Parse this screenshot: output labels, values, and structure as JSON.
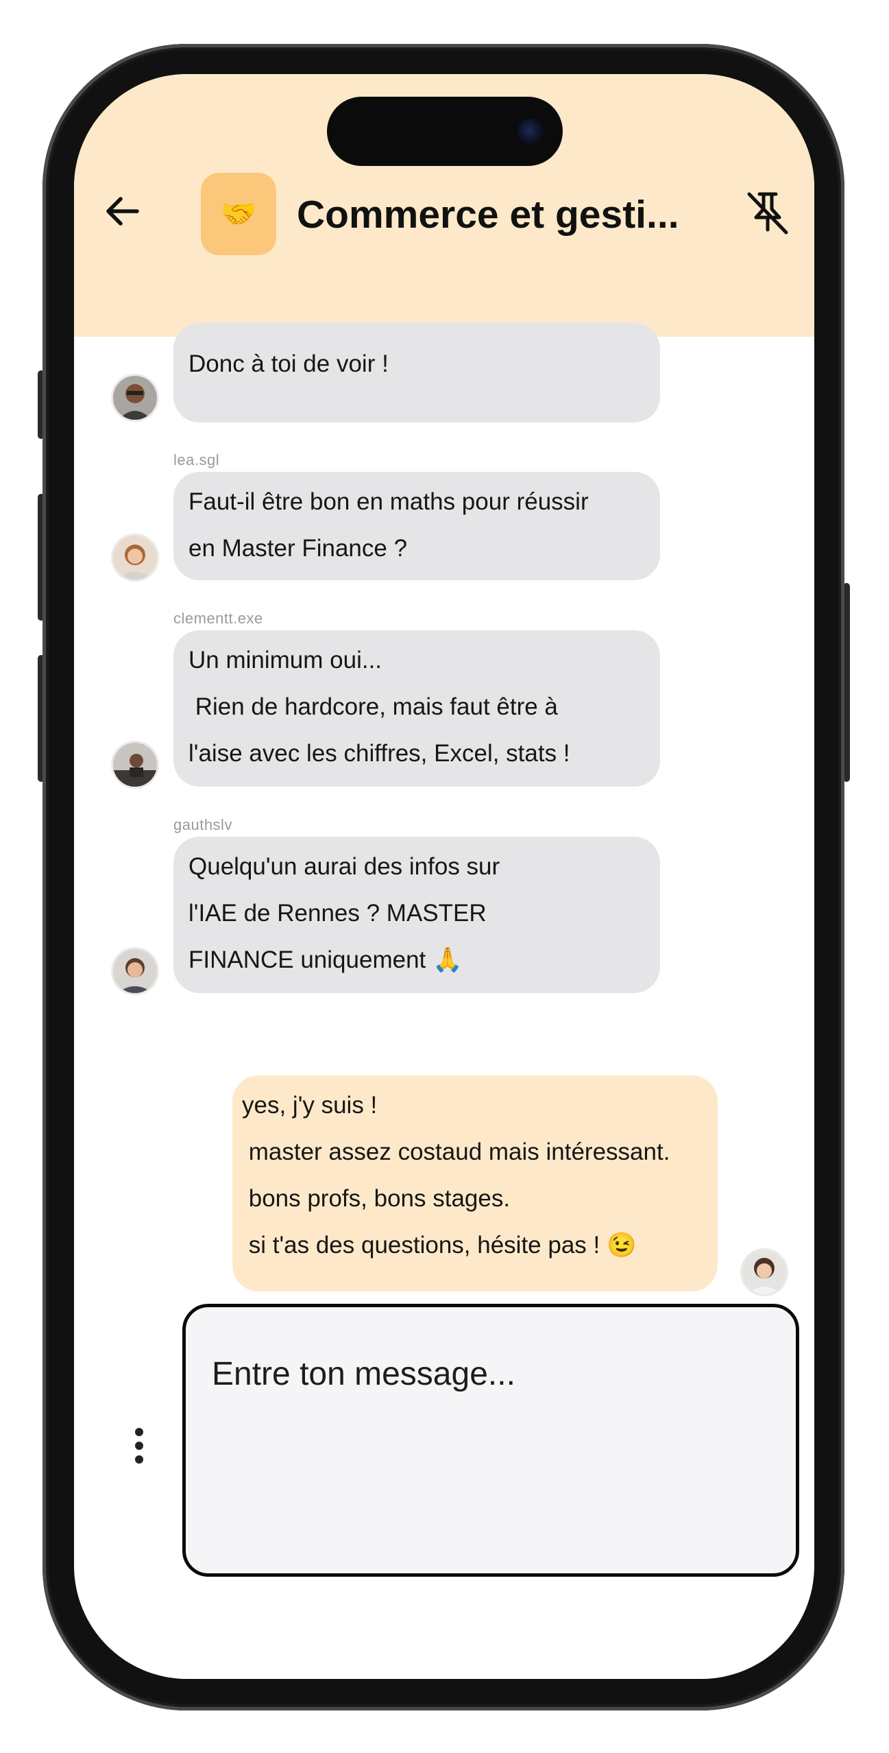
{
  "header": {
    "group_icon_emoji": "🤝",
    "title": "Commerce et gesti...",
    "back_icon": "arrow-left-icon",
    "unpin_icon": "pin-off-icon"
  },
  "messages": [
    {
      "user": "",
      "lines": [
        "Donc à toi de voir !"
      ]
    },
    {
      "user": "lea.sgl",
      "lines": [
        "Faut-il être bon en maths pour réussir",
        "en Master Finance ?"
      ]
    },
    {
      "user": "clementt.exe",
      "lines": [
        "Un minimum oui...",
        " Rien de hardcore, mais faut être à",
        "l'aise avec les chiffres, Excel, stats !"
      ]
    },
    {
      "user": "gauthslv",
      "lines": [
        "Quelqu'un aurai des infos sur",
        "l'IAE de Rennes ? MASTER",
        "FINANCE uniquement 🙏"
      ]
    }
  ],
  "my_message": {
    "lines": [
      "yes, j'y suis !",
      " master assez costaud mais intéressant.",
      " bons profs, bons stages.",
      " si t'as des questions, hésite pas ! 😉"
    ]
  },
  "composer": {
    "placeholder": "Entre ton message..."
  },
  "colors": {
    "header_bg": "#fde9c9",
    "group_icon_bg": "#fbc77b",
    "bubble_other": "#e5e5e7",
    "bubble_mine": "#fde9c9"
  }
}
